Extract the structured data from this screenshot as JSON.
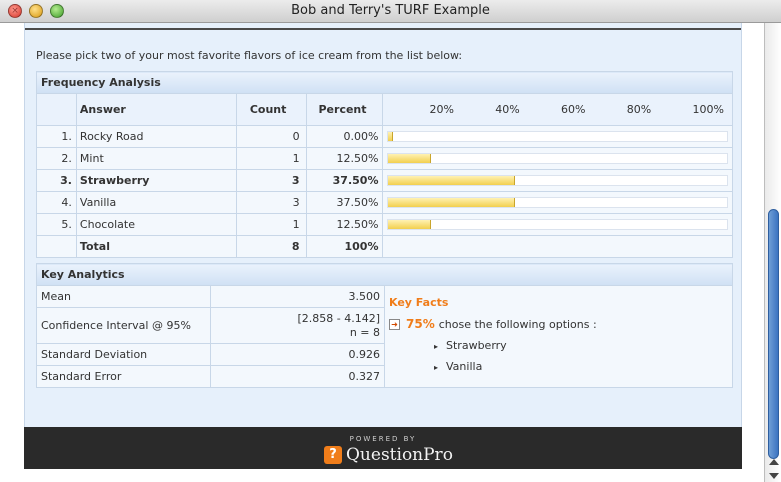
{
  "window": {
    "title": "Bob and Terry's TURF Example"
  },
  "intro": "Please pick two of your most favorite flavors of ice cream from the list below:",
  "frequency": {
    "title": "Frequency Analysis",
    "headers": {
      "answer": "Answer",
      "count": "Count",
      "percent": "Percent"
    },
    "scale": [
      "20%",
      "40%",
      "60%",
      "80%",
      "100%"
    ],
    "rows": [
      {
        "num": "1.",
        "answer": "Rocky Road",
        "count": "0",
        "percent": "0.00%",
        "value": 0.0,
        "bold": false
      },
      {
        "num": "2.",
        "answer": "Mint",
        "count": "1",
        "percent": "12.50%",
        "value": 12.5,
        "bold": false
      },
      {
        "num": "3.",
        "answer": "Strawberry",
        "count": "3",
        "percent": "37.50%",
        "value": 37.5,
        "bold": true
      },
      {
        "num": "4.",
        "answer": "Vanilla",
        "count": "3",
        "percent": "37.50%",
        "value": 37.5,
        "bold": false
      },
      {
        "num": "5.",
        "answer": "Chocolate",
        "count": "1",
        "percent": "12.50%",
        "value": 12.5,
        "bold": false
      }
    ],
    "total": {
      "label": "Total",
      "count": "8",
      "percent": "100%"
    }
  },
  "key_analytics": {
    "title": "Key Analytics",
    "metrics": [
      {
        "label": "Mean",
        "value": "3.500",
        "extra": ""
      },
      {
        "label": "Confidence Interval @ 95%",
        "value": "[2.858 - 4.142]",
        "extra": "n = 8"
      },
      {
        "label": "Standard Deviation",
        "value": "0.926",
        "extra": ""
      },
      {
        "label": "Standard Error",
        "value": "0.327",
        "extra": ""
      }
    ],
    "facts": {
      "title": "Key Facts",
      "percent": "75%",
      "text": "chose the following options :",
      "options": [
        "Strawberry",
        "Vanilla"
      ]
    }
  },
  "footer": {
    "powered_by": "POWERED BY",
    "brand": "QuestionPro"
  },
  "colors": {
    "accent": "#f07d1a",
    "bar": "#f2cf4e",
    "panel": "#e6f0fb",
    "footer": "#2a2a2a"
  }
}
